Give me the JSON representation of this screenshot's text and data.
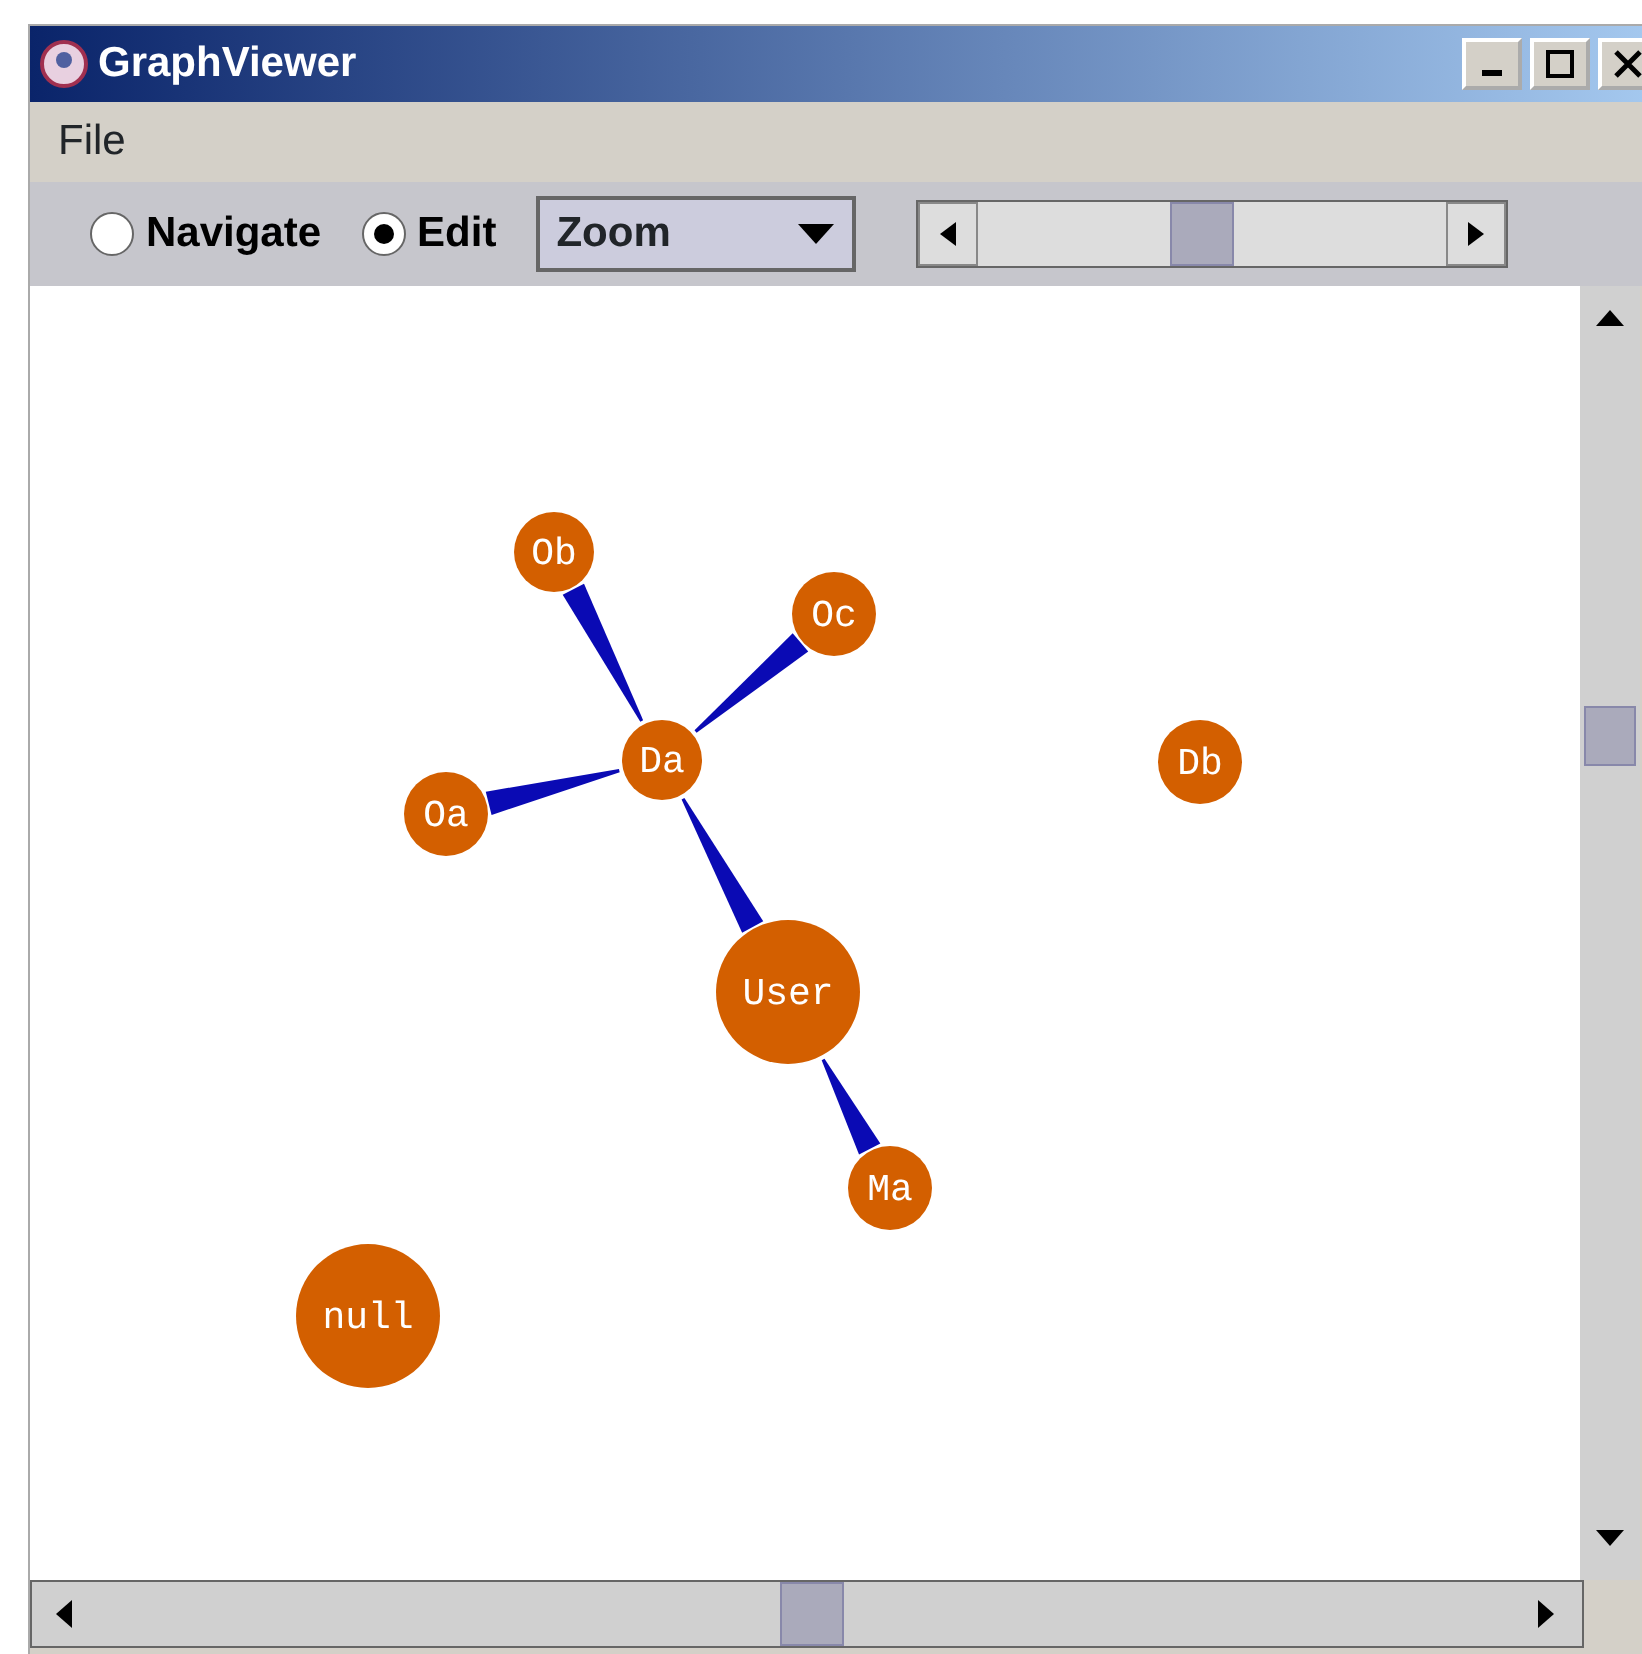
{
  "window": {
    "title": "GraphViewer"
  },
  "menu": [
    "File"
  ],
  "toolbar": {
    "modes": [
      {
        "label": "Navigate",
        "selected": false
      },
      {
        "label": "Edit",
        "selected": true
      }
    ],
    "dropdown": {
      "value": "Zoom"
    },
    "zoom_slider": {
      "level": 0.47
    }
  },
  "graph": {
    "nodes": [
      {
        "label": "Da",
        "children": [
          {
            "label": "Ob"
          },
          {
            "label": "Oc"
          },
          {
            "label": "Oa"
          },
          {
            "label": "User",
            "children": [
              {
                "label": "Ma"
              }
            ]
          }
        ]
      },
      {
        "label": "Db"
      },
      {
        "label": "null"
      }
    ]
  }
}
